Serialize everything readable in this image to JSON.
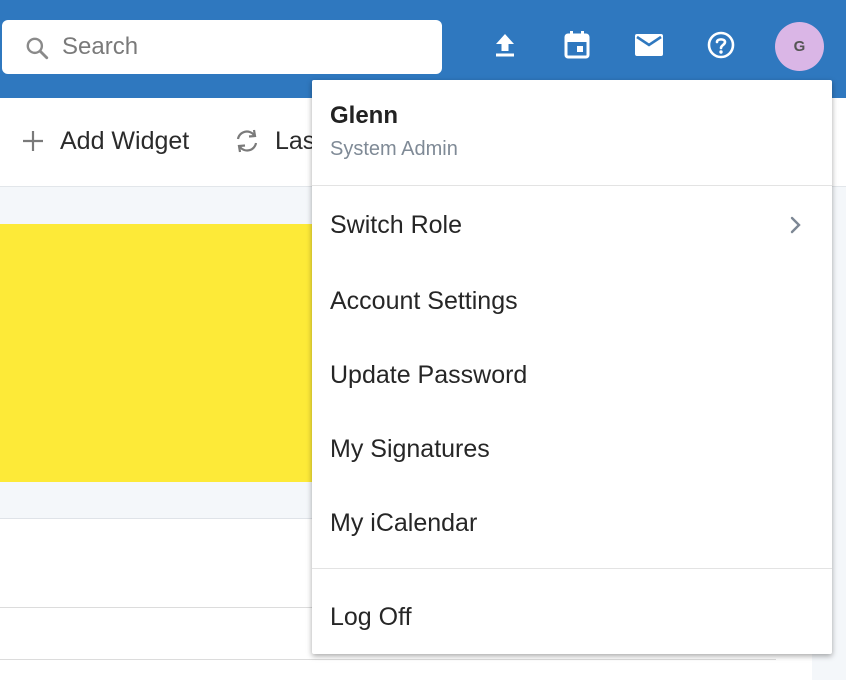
{
  "search": {
    "placeholder": "Search",
    "icon": "search-icon"
  },
  "topbar": {
    "icons": [
      "upload-icon",
      "calendar-icon",
      "mail-icon",
      "help-icon"
    ],
    "avatar_initial": "G",
    "bar_color": "#2f78bf",
    "avatar_color": "#dab6e6"
  },
  "toolbar": {
    "add_widget_label": "Add Widget",
    "last_label": "Las"
  },
  "user_menu": {
    "name": "Glenn",
    "role": "System Admin",
    "items": [
      {
        "label": "Switch Role",
        "has_submenu": true
      },
      {
        "label": "Account Settings"
      },
      {
        "label": "Update Password"
      },
      {
        "label": "My Signatures"
      },
      {
        "label": "My iCalendar"
      }
    ],
    "log_off_label": "Log Off"
  },
  "content": {
    "card_color": "#fdea38"
  }
}
